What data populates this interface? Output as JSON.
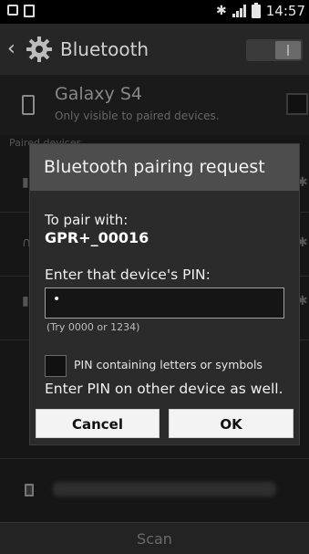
{
  "status_bar": {
    "time": "14:57",
    "icons": [
      "screenshot-icon",
      "download-icon",
      "bluetooth-icon",
      "signal-icon",
      "battery-icon"
    ]
  },
  "action_bar": {
    "title": "Bluetooth",
    "icons": [
      "back-icon",
      "gear-icon"
    ]
  },
  "device": {
    "name": "Galaxy S4",
    "visibility": "Only visible to paired devices."
  },
  "paired_header": "Paired devices",
  "scan_label": "Scan",
  "dialog": {
    "title": "Bluetooth pairing request",
    "pair_with_label": "To pair with:",
    "device_id": "GPR+_00016",
    "pin_prompt": "Enter that device's PIN:",
    "pin_value": "•",
    "pin_hint": "(Try 0000 or 1234)",
    "letters_label": "PIN containing letters or symbols",
    "other_device_note": "Enter PIN on other device as well.",
    "cancel_label": "Cancel",
    "ok_label": "OK"
  },
  "colors": {
    "dialog_title_bg": "#4d4d4d",
    "dialog_bg": "#2b2b2b",
    "button_bg": "#f3f3f3"
  }
}
